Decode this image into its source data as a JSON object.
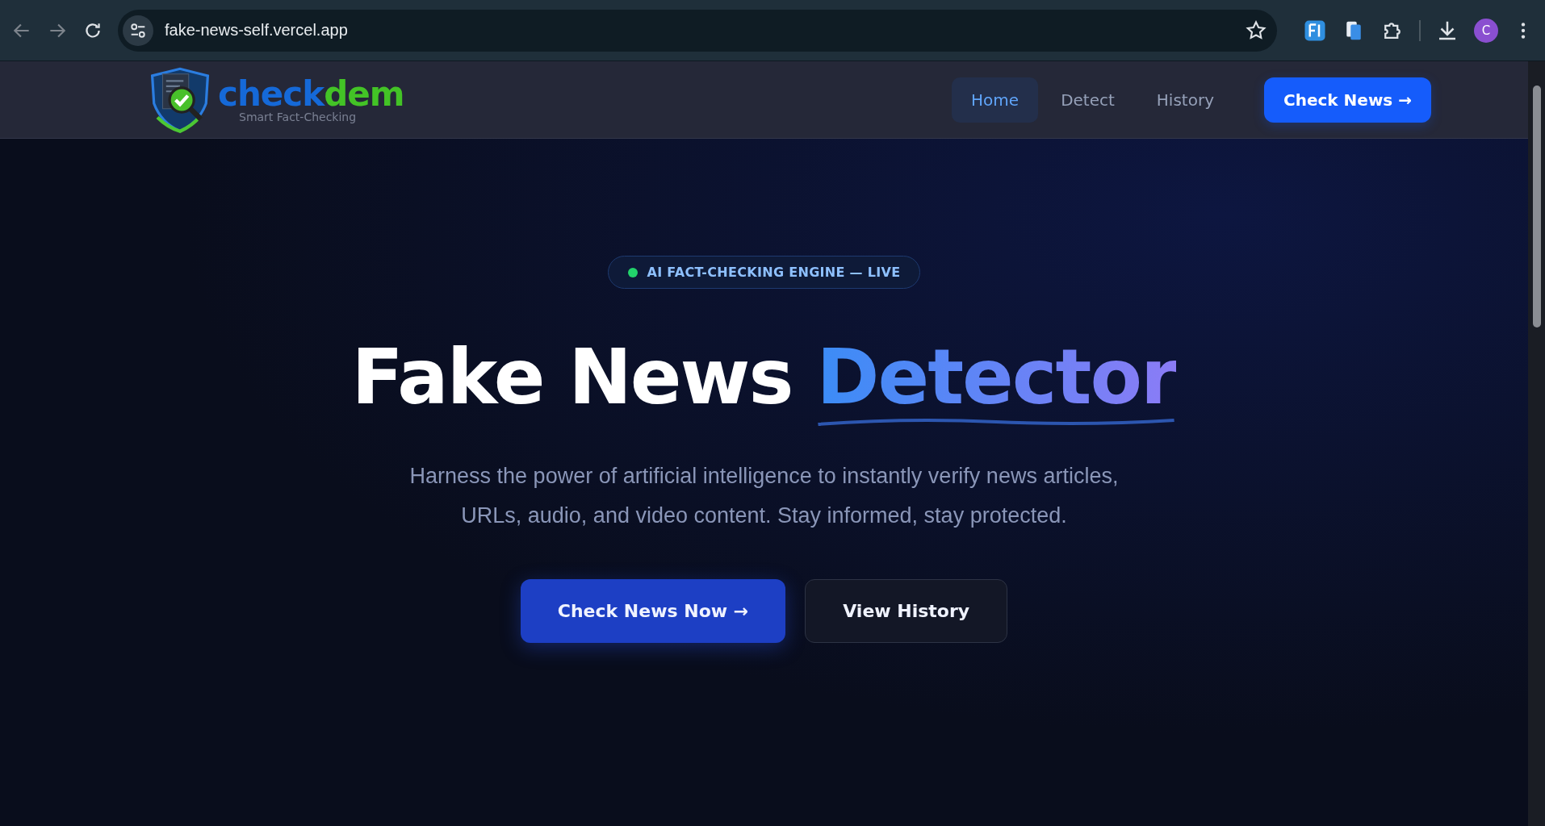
{
  "browser": {
    "url": "fake-news-self.vercel.app",
    "profile_initial": "C"
  },
  "logo": {
    "name_parts": [
      "check",
      "dem"
    ],
    "tagline": "Smart Fact-Checking"
  },
  "nav": {
    "items": [
      {
        "label": "Home",
        "selected": true
      },
      {
        "label": "Detect",
        "selected": false
      },
      {
        "label": "History",
        "selected": false
      }
    ],
    "cta": "Check News →"
  },
  "hero": {
    "badge": {
      "text": "AI FACT-CHECKING ENGINE — LIVE",
      "color": "#22d36b"
    },
    "title": "Fake News",
    "title_highlight": "Detector",
    "description": "Harness the power of artificial intelligence to instantly verify news articles, URLs, audio, and video content. Stay informed, stay protected.",
    "buttons": [
      {
        "label": "Check News Now →",
        "kind": "primary"
      },
      {
        "label": "View History",
        "kind": "secondary"
      }
    ]
  }
}
